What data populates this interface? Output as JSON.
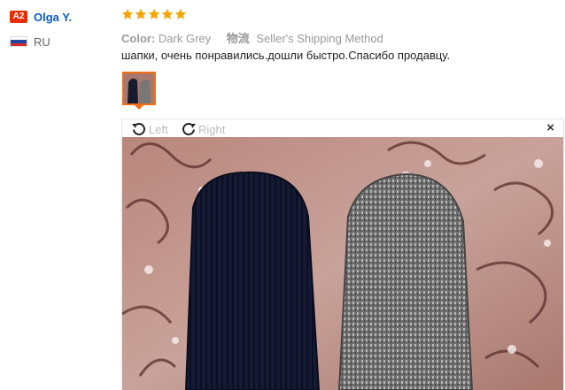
{
  "user": {
    "level_badge": "A2",
    "name": "Olga Y.",
    "country_code": "RU",
    "flag_icon": "russia-flag-icon"
  },
  "rating": {
    "stars": 5,
    "max": 5,
    "color": "#f6a400"
  },
  "attributes": {
    "color_key": "Color:",
    "color_value": "Dark Grey",
    "shipping_key": "物流",
    "shipping_value": "Seller's Shipping Method"
  },
  "review": {
    "text": "шапки, очень понравились.дошли быстро.Спасибо продавцу."
  },
  "viewer": {
    "rotate_left_label": "Left",
    "rotate_right_label": "Right",
    "close_label": "×"
  },
  "colors": {
    "accent": "#f36f16",
    "link": "#0a5ac3",
    "badge": "#e62e04"
  }
}
